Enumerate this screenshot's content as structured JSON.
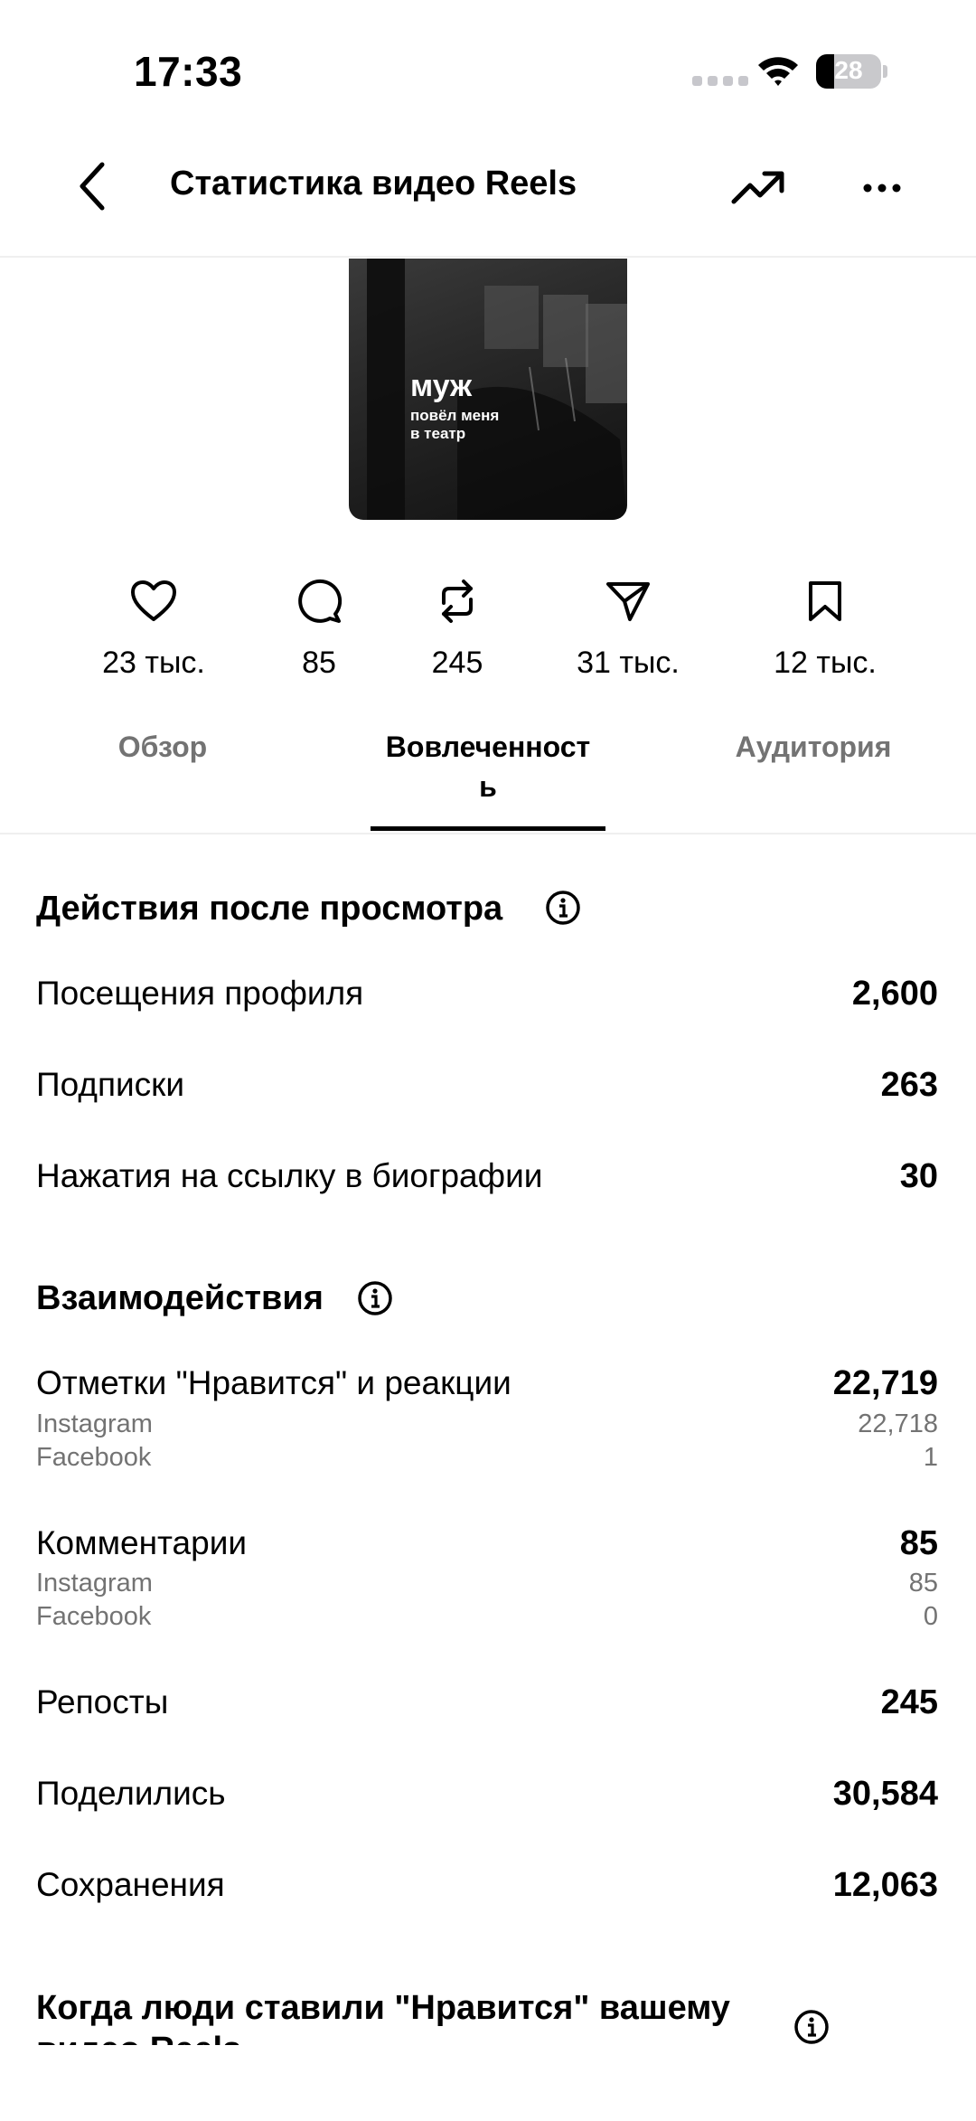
{
  "status_bar": {
    "time": "17:33",
    "battery_level": 28,
    "battery_text": "28"
  },
  "header": {
    "title": "Статистика видео Reels"
  },
  "thumbnail": {
    "line1": "муж",
    "line2": "повёл меня",
    "line3": "в театр"
  },
  "stats": [
    {
      "icon": "heart-icon",
      "value": "23 тыс."
    },
    {
      "icon": "comment-icon",
      "value": "85"
    },
    {
      "icon": "repost-icon",
      "value": "245"
    },
    {
      "icon": "share-icon",
      "value": "31 тыс."
    },
    {
      "icon": "bookmark-icon",
      "value": "12 тыс."
    }
  ],
  "tabs": [
    {
      "label": "Обзор",
      "active": false
    },
    {
      "label_line1": "Вовлеченност",
      "label_line2": "ь",
      "active": true
    },
    {
      "label": "Аудитория",
      "active": false
    }
  ],
  "after_view": {
    "title": "Действия после просмотра",
    "rows": [
      {
        "label": "Посещения профиля",
        "value": "2,600"
      },
      {
        "label": "Подписки",
        "value": "263"
      },
      {
        "label": "Нажатия на ссылку в биографии",
        "value": "30"
      }
    ]
  },
  "interactions": {
    "title": "Взаимодействия",
    "likes": {
      "label": "Отметки \"Нравится\" и реакции",
      "value": "22,719",
      "sub": [
        {
          "label": "Instagram",
          "value": "22,718"
        },
        {
          "label": "Facebook",
          "value": "1"
        }
      ]
    },
    "comments": {
      "label": "Комментарии",
      "value": "85",
      "sub": [
        {
          "label": "Instagram",
          "value": "85"
        },
        {
          "label": "Facebook",
          "value": "0"
        }
      ]
    },
    "rows": [
      {
        "label": "Репосты",
        "value": "245"
      },
      {
        "label": "Поделились",
        "value": "30,584"
      },
      {
        "label": "Сохранения",
        "value": "12,063"
      }
    ]
  },
  "likes_time": {
    "title_line1": "Когда люди ставили \"Нравится\" вашему",
    "title_line2": "видео Reels"
  }
}
